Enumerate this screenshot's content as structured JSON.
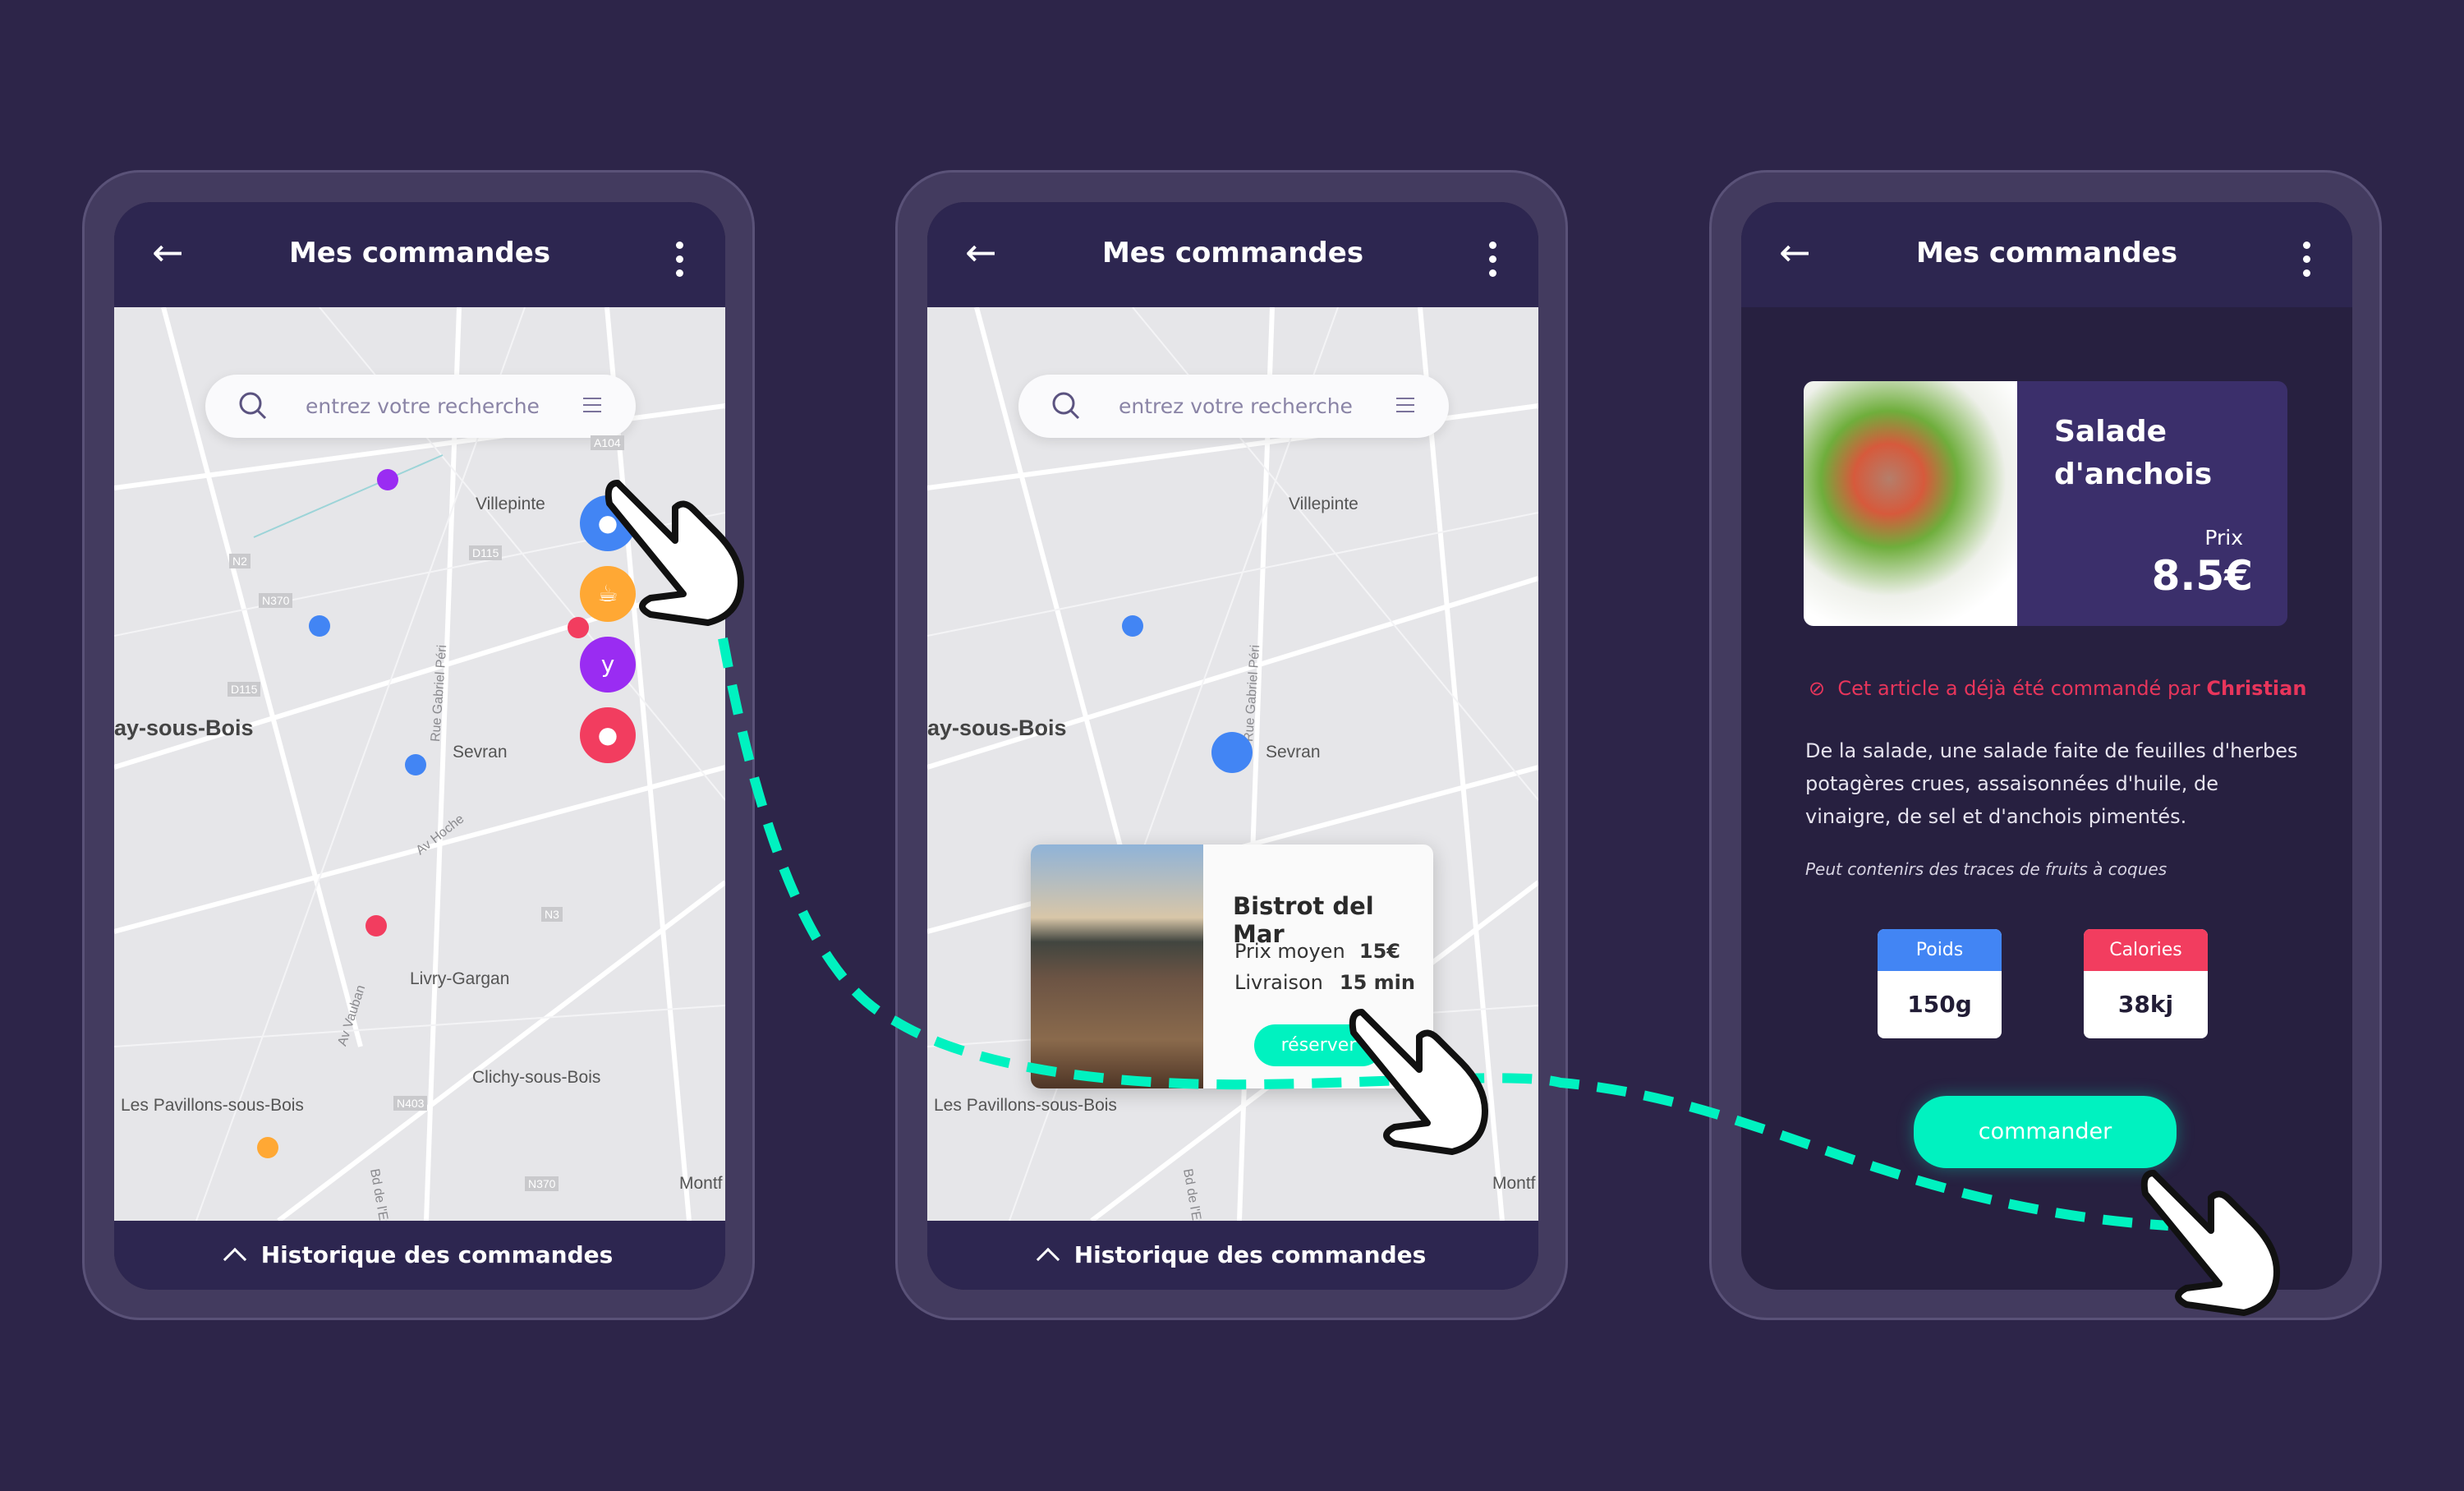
{
  "header": {
    "title": "Mes commandes"
  },
  "search": {
    "placeholder": "entrez votre recherche"
  },
  "footer": {
    "label": "Historique des commandes"
  },
  "map": {
    "places": [
      "Villepinte",
      "ay-sous-Bois",
      "Sevran",
      "Livry-Gargan",
      "Clichy-sous-Bois",
      "Les Pavillons-sous-Bois",
      "Montf"
    ],
    "roads": [
      "A104",
      "D115",
      "N2",
      "N370",
      "D115",
      "N3",
      "N403",
      "N370"
    ],
    "street_labels": [
      "Rue Gabriel Péri",
      "Av Hoche",
      "Av Vauban",
      "Bd de l'Europe"
    ],
    "categories": [
      {
        "icon": "food-icon",
        "color": "#4285f4"
      },
      {
        "icon": "coffee-icon",
        "color": "#ffa834"
      },
      {
        "icon": "cocktail-icon",
        "color": "#9a2cf2"
      },
      {
        "icon": "dessert-icon",
        "color": "#f23d5f"
      }
    ]
  },
  "restaurant": {
    "name": "Bistrot del Mar",
    "price_label": "Prix moyen",
    "price": "15€",
    "delivery_label": "Livraison",
    "delivery": "15 min",
    "button": "réserver"
  },
  "product": {
    "name_line1": "Salade",
    "name_line2": "d'anchois",
    "price_label": "Prix",
    "price": "8.5€",
    "warning": "Cet article a déjà été commandé par ",
    "warning_user": "Christian",
    "description": "De la salade, une salade faite de feuilles d'herbes potagères crues, assaisonnées d'huile, de vinaigre, de sel et d'anchois pimentés.",
    "allergen_note": "Peut contenirs des traces de fruits à coques",
    "weight_label": "Poids",
    "weight": "150g",
    "calories_label": "Calories",
    "calories": "38kj",
    "order_button": "commander"
  },
  "colors": {
    "background": "#2d2549",
    "accent": "#00f2c0",
    "blue": "#4285f4",
    "red": "#f23d5f",
    "orange": "#ffa834",
    "purple": "#9a2cf2"
  }
}
